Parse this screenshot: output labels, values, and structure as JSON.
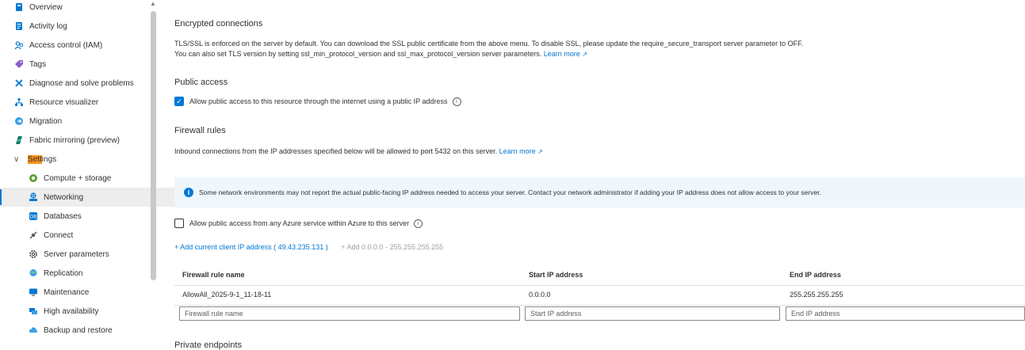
{
  "sidebar": {
    "items": [
      {
        "label": "Overview",
        "icon": "overview-icon"
      },
      {
        "label": "Activity log",
        "icon": "activity-log-icon"
      },
      {
        "label": "Access control (IAM)",
        "icon": "access-control-icon"
      },
      {
        "label": "Tags",
        "icon": "tag-icon"
      },
      {
        "label": "Diagnose and solve problems",
        "icon": "wrench-icon"
      },
      {
        "label": "Resource visualizer",
        "icon": "resource-visualizer-icon"
      },
      {
        "label": "Migration",
        "icon": "migration-icon"
      },
      {
        "label": "Fabric mirroring (preview)",
        "icon": "fabric-icon"
      },
      {
        "label_highlight": "Sett",
        "label_rest": "ings",
        "icon": "chevron-down-icon"
      },
      {
        "label": "Compute + storage",
        "icon": "compute-icon"
      },
      {
        "label": "Networking",
        "icon": "networking-icon"
      },
      {
        "label": "Databases",
        "icon": "database-icon"
      },
      {
        "label": "Connect",
        "icon": "connect-icon"
      },
      {
        "label": "Server parameters",
        "icon": "gear-icon"
      },
      {
        "label": "Replication",
        "icon": "globe-icon"
      },
      {
        "label": "Maintenance",
        "icon": "monitor-icon"
      },
      {
        "label": "High availability",
        "icon": "high-availability-icon"
      },
      {
        "label": "Backup and restore",
        "icon": "cloud-icon"
      }
    ]
  },
  "encrypted": {
    "heading": "Encrypted connections",
    "line1": "TLS/SSL is enforced on the server by default. You can download the SSL public certificate from the above menu. To disable SSL, please update the require_secure_transport server parameter to OFF.",
    "line2": "You can also set TLS version by setting ssl_min_protocol_version and ssl_max_protocol_version server parameters.",
    "learn_more": "Learn more"
  },
  "public_access": {
    "heading": "Public access",
    "checkbox_label": "Allow public access to this resource through the internet using a public IP address"
  },
  "firewall": {
    "heading": "Firewall rules",
    "description": "Inbound connections from the IP addresses specified below will be allowed to port 5432 on this server.",
    "learn_more": "Learn more",
    "banner": "Some network environments may not report the actual public-facing IP address needed to access your server.  Contact your network administrator if adding your IP address does not allow access to your server.",
    "azure_checkbox_label": "Allow public access from any Azure service within Azure to this server",
    "add_client_ip": "+ Add current client IP address ( 49.43.235.131 )",
    "add_all": "+ Add 0.0.0.0 - 255.255.255.255",
    "columns": [
      "Firewall rule name",
      "Start IP address",
      "End IP address"
    ],
    "rows": [
      {
        "name": "AllowAll_2025-9-1_11-18-11",
        "start": "0.0.0.0",
        "end": "255.255.255.255"
      }
    ],
    "placeholders": {
      "name": "Firewall rule name",
      "start": "Start IP address",
      "end": "End IP address"
    }
  },
  "private_endpoints": {
    "heading": "Private endpoints"
  },
  "colors": {
    "accent": "#0078d4",
    "selected_bg": "#ededed",
    "banner_bg": "#eff6fc",
    "highlight": "#f7941d"
  }
}
